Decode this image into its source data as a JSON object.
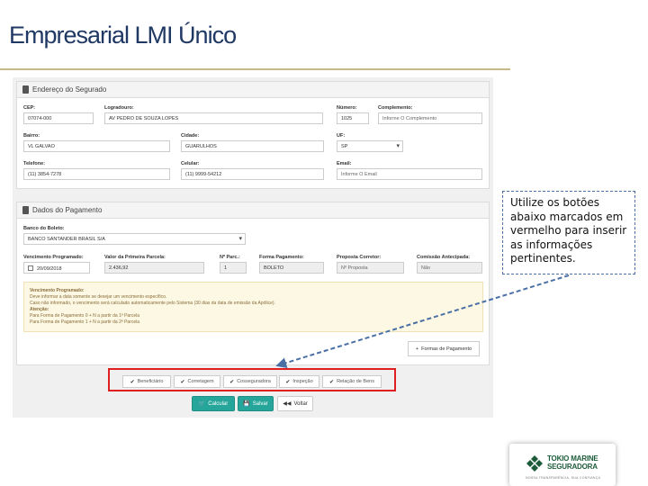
{
  "slide": {
    "title": "Empresarial LMI Único",
    "callout_text": "Utilize os botões abaixo marcados em vermelho para inserir as informações pertinentes."
  },
  "address": {
    "title": "Endereço do Segurado",
    "fields": {
      "cep": {
        "label": "CEP:",
        "value": "07074-000"
      },
      "logradouro": {
        "label": "Logradouro:",
        "value": "AV PEDRO DE SOUZA LOPES"
      },
      "numero": {
        "label": "Número:",
        "value": "1025"
      },
      "complemento": {
        "label": "Complemento:",
        "value": "Informe O Complemento"
      },
      "bairro": {
        "label": "Bairro:",
        "value": "VL GALVAO"
      },
      "cidade": {
        "label": "Cidade:",
        "value": "GUARULHOS"
      },
      "uf": {
        "label": "UF:",
        "value": "SP"
      },
      "telefone": {
        "label": "Telefone:",
        "value": "(11) 3854-7278"
      },
      "celular": {
        "label": "Celular:",
        "value": "(11) 9999-54212"
      },
      "email": {
        "label": "Email:",
        "value": "Informe O Email"
      }
    }
  },
  "payment": {
    "title": "Dados do Pagamento",
    "bank": {
      "label": "Banco do Boleto:",
      "value": "BANCO SANTANDER BRASIL S/A"
    },
    "fields": {
      "vencimento": {
        "label": "Vencimento Programado:",
        "value": "20/09/2018"
      },
      "valor": {
        "label": "Valor da Primeira Parcela:",
        "value": "2.436,92"
      },
      "parcelas": {
        "label": "Nº Parc.:",
        "value": "1"
      },
      "forma": {
        "label": "Forma Pagamento:",
        "value": "BOLETO"
      },
      "proposta": {
        "label": "Proposta Corretor:",
        "value": "Nº Proposta"
      },
      "comissao": {
        "label": "Comissão Antecipada:",
        "value": "Não"
      }
    },
    "note": {
      "heading": "Vencimento Programado:",
      "line1": "Deve informar a data somente se desejar um vencimento específico.",
      "line2": "Caso não informado, o vencimento será calculado automaticamente pelo Sistema (30 dias da data de emissão da Apólice).",
      "attention": "Atenção:",
      "line3": "Para Forma de Pagamento 0 + N a partir da 1ª Parcela",
      "line4": "Para Forma de Pagamento 1 + N a partir da 2ª Parcela"
    },
    "forma_button": "Formas de Pagamento"
  },
  "tabs": [
    {
      "label": "Beneficiário"
    },
    {
      "label": "Corretagem"
    },
    {
      "label": "Cosseguradora"
    },
    {
      "label": "Inspeção"
    },
    {
      "label": "Relação de Bens"
    }
  ],
  "actions": {
    "calcular": "Calcular",
    "salvar": "Salvar",
    "voltar": "Voltar"
  },
  "logo": {
    "line1": "TOKIO MARINE",
    "line2": "SEGURADORA",
    "tagline": "NOSSA TRANSPARÊNCIA, SUA CONFIANÇA"
  },
  "colors": {
    "title": "#1f3864",
    "highlight_border": "#e02020",
    "action_green": "#26a69a",
    "callout_border": "#4a6fa5"
  }
}
